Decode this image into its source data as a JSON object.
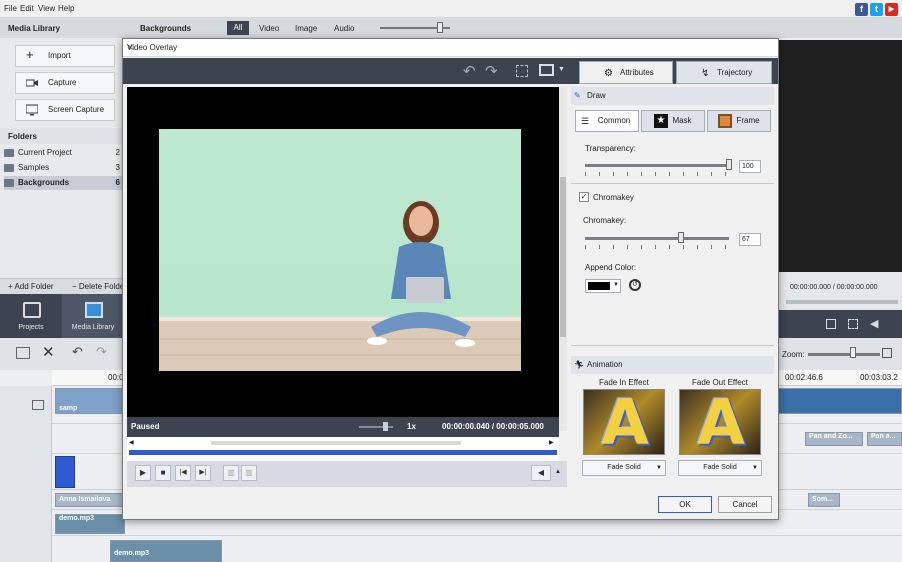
{
  "menu": {
    "file": "File",
    "edit": "Edit",
    "view": "View",
    "help": "Help"
  },
  "social": {
    "facebook": "f",
    "twitter": "t",
    "youtube": "▶"
  },
  "topbar": {
    "media_library": "Media Library",
    "backgrounds": "Backgrounds",
    "filter_all": "All",
    "filter_video": "Video",
    "filter_image": "Image",
    "filter_audio": "Audio"
  },
  "library": {
    "import": "Import",
    "capture": "Capture",
    "screen_capture": "Screen Capture",
    "folders_title": "Folders",
    "folders": [
      {
        "name": "Current Project",
        "count": "2"
      },
      {
        "name": "Samples",
        "count": "3"
      },
      {
        "name": "Backgrounds",
        "count": "6"
      }
    ],
    "add_folder": "+ Add Folder",
    "delete_folder": "− Delete Folder",
    "tab_projects": "Projects",
    "tab_media": "Media Library"
  },
  "rightpane": {
    "time": "00:00:00.000 / 00:00:00.000",
    "zoom": "Zoom:"
  },
  "timeline": {
    "ruler_left": "00:0",
    "ruler_r1": "00:02:46.6",
    "ruler_r2": "00:03:03.2",
    "clip_sample": "samp",
    "clip_anna": "Anna Ismailova",
    "clip_demo1": "demo.mp3",
    "clip_demo2": "demo.mp3",
    "clip_panzoom1": "Pan and Zo...",
    "clip_panzoom2": "Pan a...",
    "clip_som": "Som..."
  },
  "dialog": {
    "title": "Video Overlay",
    "close": "✕",
    "tab_attributes": "Attributes",
    "tab_trajectory": "Trajectory",
    "status": "Paused",
    "speed": "1x",
    "time": "00:00:00.040 / 00:00:05.000",
    "draw": "Draw",
    "sub_common": "Common",
    "sub_mask": "Mask",
    "sub_frame": "Frame",
    "transparency_label": "Transparency:",
    "transparency_value": "100",
    "transparency_level": 1.0,
    "chromakey_section": "Chromakey",
    "chromakey_label": "Chromakey:",
    "chromakey_value": "67",
    "chromakey_level": 0.67,
    "append_color_label": "Append Color:",
    "append_color": "#000000",
    "animation": "Animation",
    "fade_in_label": "Fade In Effect",
    "fade_out_label": "Fade Out Effect",
    "fade_in_select": "Fade Solid",
    "fade_out_select": "Fade Solid",
    "effect_letter": "A",
    "ok": "OK",
    "cancel": "Cancel"
  },
  "colors": {
    "dark_ui": "#3c4452",
    "accent_blue": "#2f5bd0",
    "wall": "#bde8d0"
  }
}
